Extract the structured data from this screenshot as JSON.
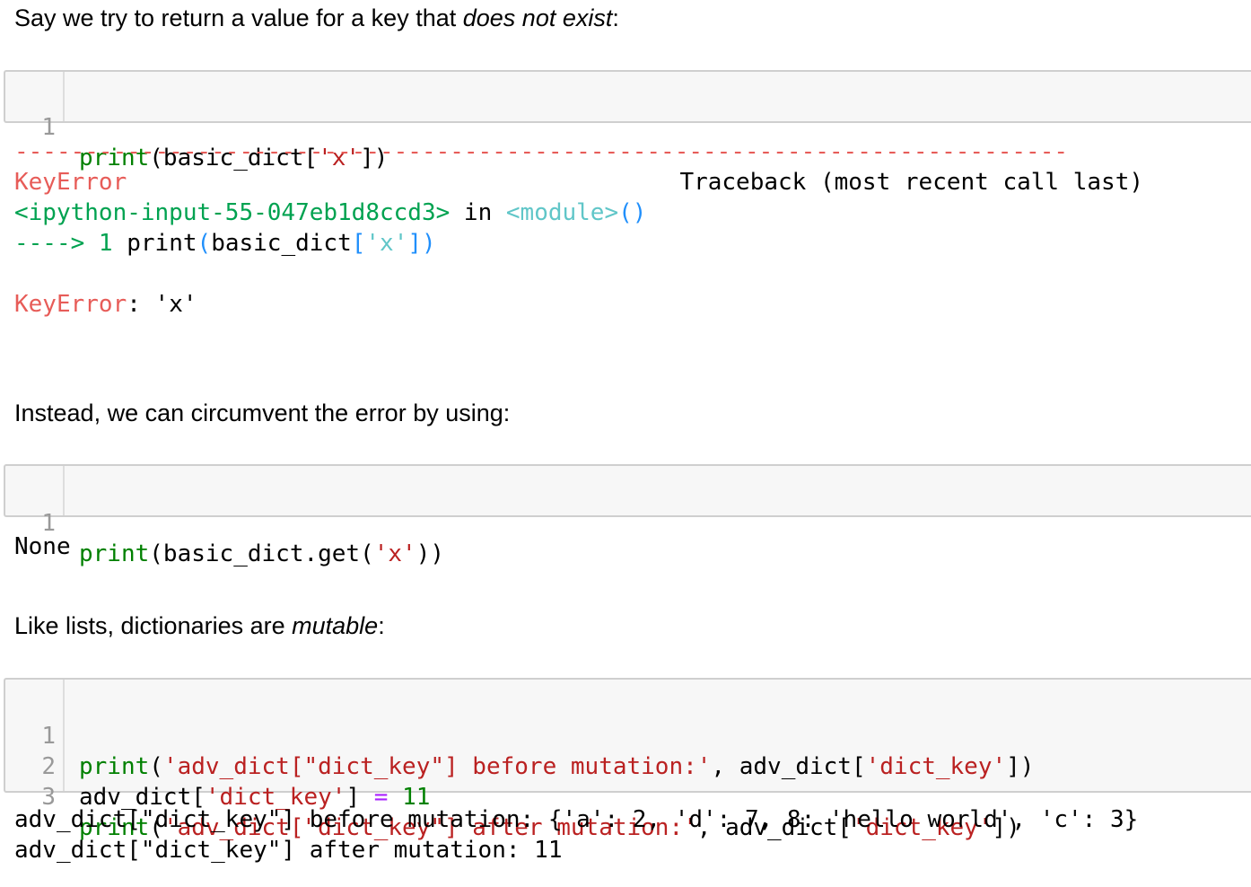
{
  "markdown": {
    "p1": {
      "pre": "Say we try to return a value for a key that ",
      "em": "does not exist",
      "post": ":"
    },
    "p2": "Instead, we can circumvent the error by using:",
    "p3": {
      "pre": "Like lists, dictionaries are ",
      "em": "mutable",
      "post": ":"
    }
  },
  "cell1": {
    "line_numbers": [
      "1"
    ],
    "code": {
      "fn": "print",
      "open": "(basic_dict[",
      "str": "'x'",
      "close": "])"
    }
  },
  "traceback": {
    "dashes": "---------------------------------------------------------------------------",
    "error_name": "KeyError",
    "header_right": "Traceback (most recent call last)",
    "input_ref": "<ipython-input-55-047eb1d8ccd3>",
    "in_word": " in ",
    "module": "<module>",
    "parens": "()",
    "arrow": "---->",
    "line_no": " 1 ",
    "call_a": "print",
    "call_b": "(",
    "call_c": "basic_dict",
    "call_d": "[",
    "call_e": "'x'",
    "call_f": "])",
    "final_name": "KeyError",
    "final_msg": ": 'x'"
  },
  "cell2": {
    "line_numbers": [
      "1"
    ],
    "code": {
      "fn": "print",
      "open": "(basic_dict.get(",
      "str": "'x'",
      "close": "))"
    },
    "output": "None"
  },
  "cell3": {
    "line_numbers": [
      "1",
      "2",
      "3"
    ],
    "line1": {
      "fn": "print",
      "a": "(",
      "str1": "'adv_dict[\"dict_key\"] before mutation:'",
      "b": ", adv_dict[",
      "str2": "'dict_key'",
      "c": "])"
    },
    "line2": {
      "a": "adv_dict[",
      "str1": "'dict_key'",
      "b": "] ",
      "op": "=",
      "c": " ",
      "num": "11"
    },
    "line3": {
      "fn": "print",
      "a": "(",
      "str1": "'adv_dict[\"dict_key\"] after mutation:'",
      "b": ", adv_dict[",
      "str2": "'dict_key'",
      "c": "])"
    },
    "output": [
      "adv_dict[\"dict_key\"] before mutation: {'a': 2, 'd': 7, 8: 'hello world', 'c': 3}",
      "adv_dict[\"dict_key\"] after mutation: 11"
    ]
  },
  "colors": {
    "keyword": "#008000",
    "string": "#ba2121",
    "operator": "#aa22ff",
    "tb_red": "#e75c58",
    "tb_green": "#00a250",
    "tb_cyan": "#60c6c8",
    "tb_blue": "#208ffb"
  }
}
